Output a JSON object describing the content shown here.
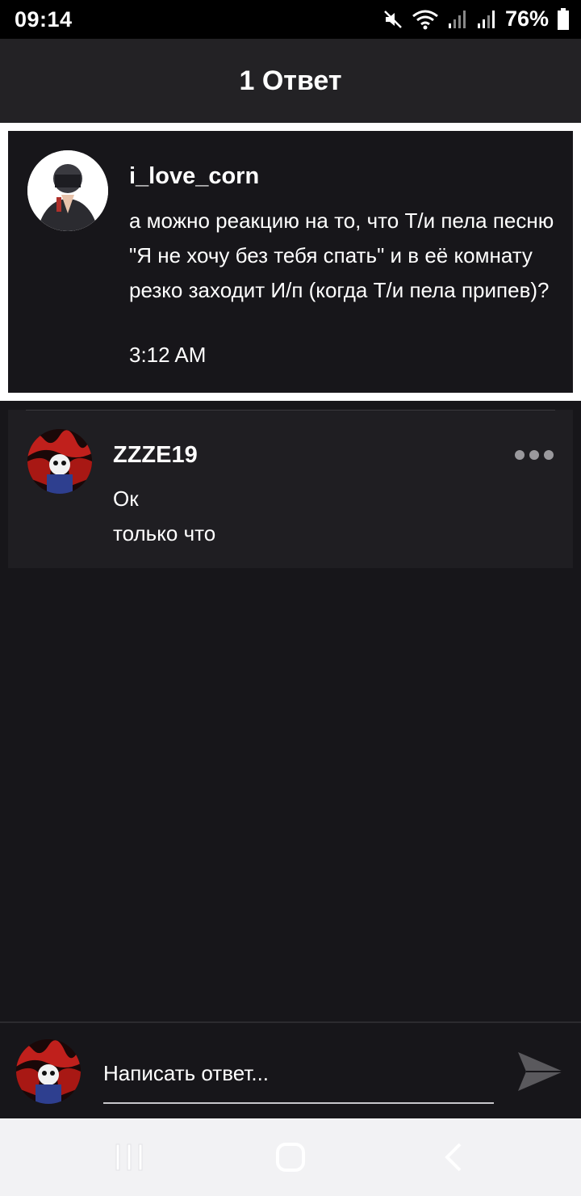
{
  "status_bar": {
    "time": "09:14",
    "battery_percent": "76%",
    "icons": [
      "mute-icon",
      "wifi-icon",
      "signal-icon",
      "signal-icon",
      "battery-icon"
    ]
  },
  "header": {
    "title": "1 Ответ"
  },
  "parent_comment": {
    "username": "i_love_corn",
    "text": "а можно реакцию на то, что Т/и пела песню \"Я не хочу без тебя спать\" и в её комнату резко заходит И/п (когда Т/и пела припев)?",
    "time": "3:12 AM"
  },
  "reply": {
    "username": "ZZZE19",
    "text": "Ок",
    "time": "только что",
    "more_icon": "more-horizontal-icon"
  },
  "composer": {
    "placeholder": "Написать ответ...",
    "send_icon": "send-icon"
  },
  "nav": {
    "items": [
      "recents-icon",
      "home-icon",
      "back-icon"
    ]
  },
  "colors": {
    "background": "#17161a",
    "header": "#232225",
    "reply_card": "#1f1e22",
    "text": "#ffffff"
  }
}
